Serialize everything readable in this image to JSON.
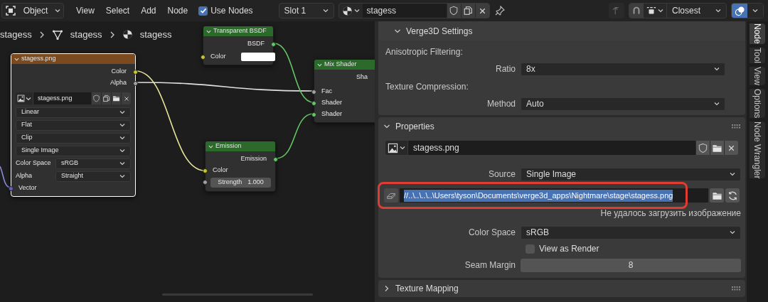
{
  "header": {
    "mode": "Object",
    "menus": [
      "View",
      "Select",
      "Add",
      "Node"
    ],
    "use_nodes": {
      "label": "Use Nodes",
      "checked": true
    },
    "slot": "Slot 1",
    "material": "stagess",
    "snap": "Closest",
    "overlays": true
  },
  "breadcrumb": [
    {
      "kind": "object",
      "label": "stagess"
    },
    {
      "kind": "mesh",
      "label": "stagess"
    },
    {
      "kind": "material",
      "label": "stagess"
    }
  ],
  "nodes": [
    {
      "kind": "image_texture",
      "title": "stagess.png",
      "selected": true,
      "outputs": [
        {
          "label": "Color",
          "kind": "color"
        },
        {
          "label": "Alpha",
          "kind": "float"
        }
      ],
      "image": "stagess.png",
      "options": [
        "Linear",
        "Flat",
        "Clip",
        "Single Image"
      ],
      "settings": [
        {
          "label": "Color Space",
          "value": "sRGB"
        },
        {
          "label": "Alpha",
          "value": "Straight"
        }
      ],
      "inputs": [
        {
          "label": "Vector",
          "kind": "vector"
        }
      ]
    },
    {
      "kind": "transparent_bsdf",
      "title": "Transparent BSDF",
      "selected": false,
      "outputs": [
        {
          "label": "BSDF",
          "kind": "shader"
        }
      ],
      "inputs": [
        {
          "label": "Color",
          "kind": "color",
          "color": "#ffffff"
        }
      ]
    },
    {
      "kind": "mix_shader",
      "title": "Mix Shader",
      "selected": false,
      "outputs": [
        {
          "label": "Sha",
          "kind": "shader"
        }
      ],
      "inputs": [
        {
          "label": "Fac",
          "kind": "float"
        },
        {
          "label": "Shader",
          "kind": "shader"
        },
        {
          "label": "Shader",
          "kind": "shader"
        }
      ]
    },
    {
      "kind": "emission",
      "title": "Emission",
      "selected": false,
      "outputs": [
        {
          "label": "Emission",
          "kind": "shader"
        }
      ],
      "inputs": [
        {
          "label": "Color",
          "kind": "color"
        },
        {
          "label": "Strength",
          "kind": "float",
          "value": "1.000"
        }
      ]
    }
  ],
  "sidebar": {
    "sections": [
      {
        "kind": "verge3d",
        "title": "Verge3D Settings",
        "expanded": true,
        "groups": [
          {
            "heading": "Anisotropic Filtering:",
            "label": "Ratio",
            "value": "8x"
          },
          {
            "heading": "Texture Compression:",
            "label": "Method",
            "value": "Auto"
          }
        ]
      },
      {
        "kind": "properties",
        "title": "Properties",
        "expanded": true,
        "image": "stagess.png",
        "source": {
          "label": "Source",
          "value": "Single Image"
        },
        "filepath": "//..\\..\\..\\..\\Users\\tyson\\Documents\\verge3d_apps\\Nightmare\\stage\\stagess.png",
        "error": "Не удалось загрузить изображение",
        "color_space": {
          "label": "Color Space",
          "value": "sRGB"
        },
        "view_as_render": {
          "label": "View as Render",
          "checked": false
        },
        "seam_margin": {
          "label": "Seam Margin",
          "value": "8"
        }
      },
      {
        "kind": "collapsed",
        "title": "Texture Mapping",
        "expanded": false
      }
    ],
    "tabs": [
      {
        "label": "Node",
        "selected": true
      },
      {
        "label": "Tool",
        "selected": false
      },
      {
        "label": "View",
        "selected": false
      },
      {
        "label": "Options",
        "selected": false
      },
      {
        "label": "Node Wrangler",
        "selected": false
      }
    ]
  }
}
